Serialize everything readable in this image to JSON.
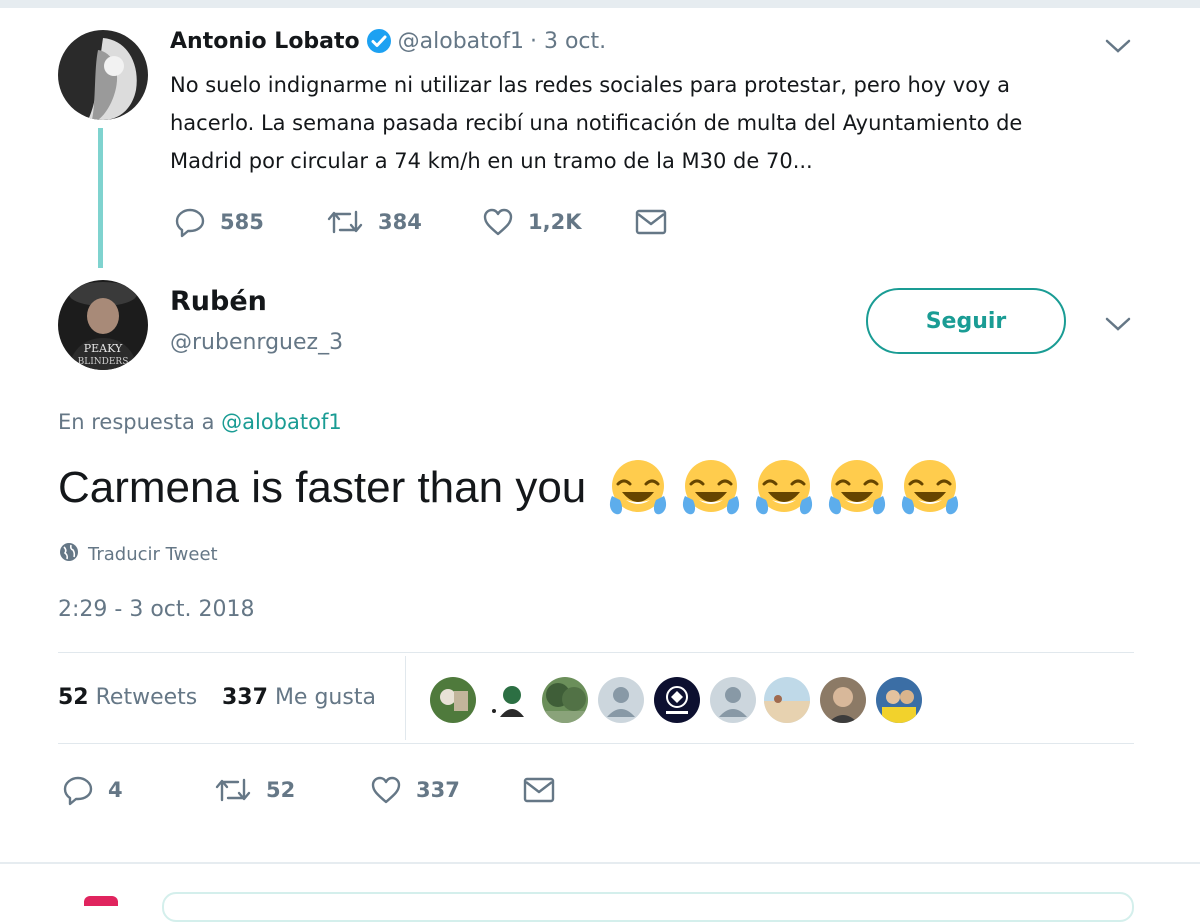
{
  "parent_tweet": {
    "display_name": "Antonio Lobato",
    "handle": "@alobatof1",
    "date": "· 3 oct.",
    "text_line1": "No suelo indignarme ni utilizar las redes sociales para protestar, pero hoy voy a",
    "text_line2": "hacerlo. La semana pasada recibí una notificación de multa del Ayuntamiento de",
    "text_line3": "Madrid por circular a 74 km/h en un tramo de la M30 de 70...",
    "reply_count": "585",
    "retweet_count": "384",
    "like_count": "1,2K"
  },
  "main_tweet": {
    "display_name": "Rubén",
    "handle": "@rubenrguez_3",
    "follow_label": "Seguir",
    "reply_prefix": "En respuesta a",
    "reply_to": "@alobatof1",
    "text": "Carmena is faster than you",
    "emoji_count": 5,
    "translate_label": "Traducir Tweet",
    "timestamp": "2:29 - 3 oct. 2018",
    "retweets_number": "52",
    "retweets_label": "Retweets",
    "likes_number": "337",
    "likes_label": "Me gusta",
    "reply_count": "4",
    "retweet_count": "52",
    "like_count": "337"
  },
  "colors": {
    "accent": "#1a9c94",
    "verified": "#1da1f2",
    "muted": "#657786"
  }
}
